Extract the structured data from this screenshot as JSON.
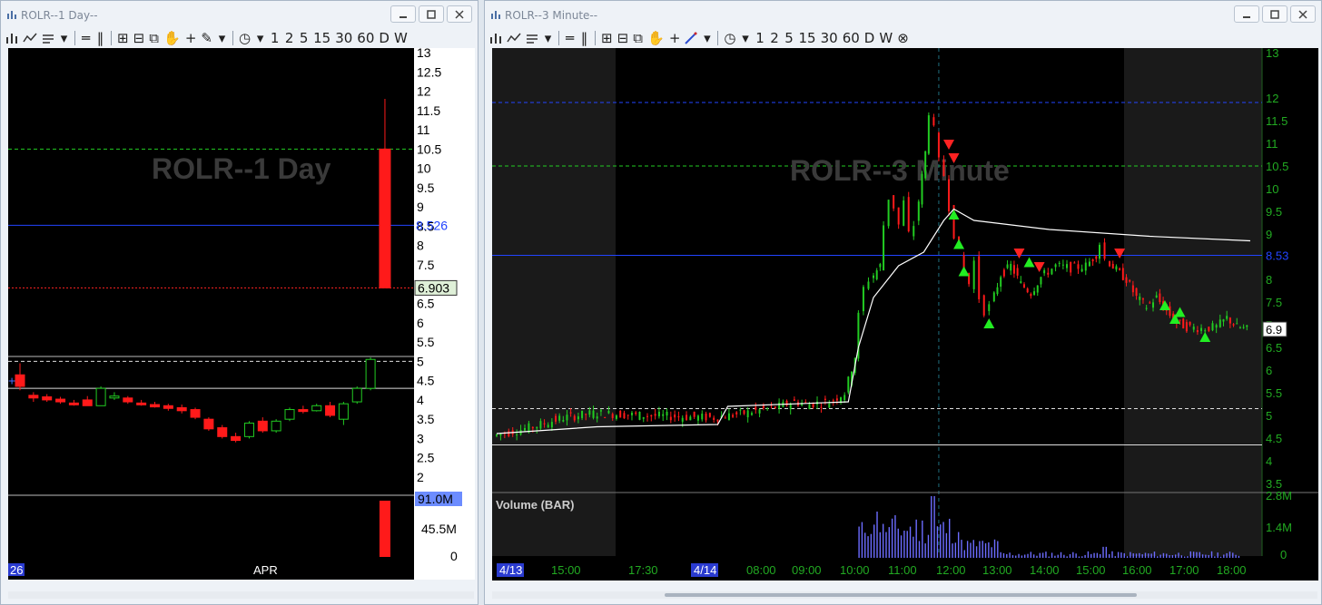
{
  "windows": {
    "left": {
      "title": "ROLR--1 Day--",
      "toolbar": [
        "1",
        "2",
        "5",
        "15",
        "30",
        "60",
        "D",
        "W"
      ],
      "watermark": "ROLR--1 Day",
      "price_tag": "8.526",
      "last_tag": "6.903",
      "vol_tag": "91.0M",
      "date_labels": [
        "26",
        "APR"
      ]
    },
    "right": {
      "title": "ROLR--3 Minute--",
      "toolbar": [
        "1",
        "2",
        "5",
        "15",
        "30",
        "60",
        "D",
        "W"
      ],
      "watermark": "ROLR--3 Minute",
      "price_tag": "8.53",
      "last_tag": "6.9",
      "volume_label": "Volume (BAR)",
      "date_labels": [
        "4/13",
        "15:00",
        "17:30",
        "4/14",
        "08:00",
        "09:00",
        "10:00",
        "11:00",
        "12:00",
        "13:00",
        "14:00",
        "15:00",
        "16:00",
        "17:00",
        "18:00"
      ]
    }
  },
  "colors": {
    "up": "#22cc22",
    "down": "#ff1a1a",
    "hline_green": "#22cc22",
    "hline_blue": "#2244ff",
    "hline_red": "#ff2222",
    "vwap": "#ffffff",
    "volume": "#6c6cff",
    "axis_text_right": "#22aa22"
  },
  "chart_data": [
    {
      "type": "candlestick",
      "title": "ROLR--1 Day",
      "ylim": [
        1.5,
        13
      ],
      "yticks": [
        "13",
        "12.5",
        "12",
        "11.5",
        "11",
        "10.5",
        "10",
        "9.5",
        "9",
        "8.5",
        "8",
        "7.5",
        "7",
        "6.5",
        "6",
        "5.5",
        "5",
        "4.5",
        "4",
        "3.5",
        "3",
        "2.5",
        "2"
      ],
      "hlines": [
        {
          "value": 10.5,
          "style": "dashed",
          "color": "green"
        },
        {
          "value": 8.526,
          "style": "solid",
          "color": "blue"
        },
        {
          "value": 6.903,
          "style": "dotted",
          "color": "red"
        },
        {
          "value": 5.0,
          "style": "dashed",
          "color": "white"
        },
        {
          "value": 4.3,
          "style": "solid",
          "color": "white"
        }
      ],
      "candles": [
        {
          "o": 4.65,
          "h": 4.95,
          "l": 4.25,
          "c": 4.35
        },
        {
          "o": 4.12,
          "h": 4.2,
          "l": 3.95,
          "c": 4.05
        },
        {
          "o": 4.08,
          "h": 4.15,
          "l": 3.95,
          "c": 4.0
        },
        {
          "o": 4.02,
          "h": 4.08,
          "l": 3.9,
          "c": 3.95
        },
        {
          "o": 3.92,
          "h": 4.0,
          "l": 3.85,
          "c": 3.88
        },
        {
          "o": 4.0,
          "h": 4.1,
          "l": 3.85,
          "c": 3.85
        },
        {
          "o": 3.85,
          "h": 4.35,
          "l": 3.85,
          "c": 4.3
        },
        {
          "o": 4.05,
          "h": 4.2,
          "l": 4.0,
          "c": 4.1
        },
        {
          "o": 4.05,
          "h": 4.1,
          "l": 3.9,
          "c": 3.95
        },
        {
          "o": 3.92,
          "h": 4.0,
          "l": 3.85,
          "c": 3.88
        },
        {
          "o": 3.88,
          "h": 3.95,
          "l": 3.8,
          "c": 3.82
        },
        {
          "o": 3.85,
          "h": 3.9,
          "l": 3.72,
          "c": 3.78
        },
        {
          "o": 3.8,
          "h": 3.88,
          "l": 3.65,
          "c": 3.72
        },
        {
          "o": 3.75,
          "h": 3.8,
          "l": 3.5,
          "c": 3.55
        },
        {
          "o": 3.5,
          "h": 3.55,
          "l": 3.2,
          "c": 3.25
        },
        {
          "o": 3.28,
          "h": 3.35,
          "l": 3.0,
          "c": 3.05
        },
        {
          "o": 3.05,
          "h": 3.15,
          "l": 2.9,
          "c": 2.95
        },
        {
          "o": 3.05,
          "h": 3.45,
          "l": 3.0,
          "c": 3.4
        },
        {
          "o": 3.45,
          "h": 3.55,
          "l": 3.15,
          "c": 3.2
        },
        {
          "o": 3.2,
          "h": 3.5,
          "l": 3.15,
          "c": 3.45
        },
        {
          "o": 3.5,
          "h": 3.8,
          "l": 3.45,
          "c": 3.75
        },
        {
          "o": 3.75,
          "h": 3.85,
          "l": 3.65,
          "c": 3.7
        },
        {
          "o": 3.72,
          "h": 3.9,
          "l": 3.7,
          "c": 3.85
        },
        {
          "o": 3.85,
          "h": 3.95,
          "l": 3.55,
          "c": 3.6
        },
        {
          "o": 3.5,
          "h": 3.95,
          "l": 3.35,
          "c": 3.9
        },
        {
          "o": 3.95,
          "h": 4.35,
          "l": 3.9,
          "c": 4.3
        },
        {
          "o": 4.3,
          "h": 5.1,
          "l": 4.25,
          "c": 5.05
        },
        {
          "o": 10.5,
          "h": 11.8,
          "l": 6.9,
          "c": 6.903
        }
      ],
      "volume": {
        "ylim": [
          0,
          91
        ],
        "yticks": [
          "91.0M",
          "45.5M",
          "0"
        ],
        "last_bar_millions": 91
      },
      "xlabels": [
        "26",
        "APR"
      ]
    },
    {
      "type": "candlestick",
      "title": "ROLR--3 Minute",
      "ylim": [
        3.5,
        13
      ],
      "yticks": [
        "13",
        "12",
        "11.5",
        "11",
        "10.5",
        "10",
        "9.5",
        "9",
        "8.53",
        "8",
        "7.5",
        "7",
        "6.5",
        "6",
        "5.5",
        "5",
        "4.5",
        "4",
        "3.5"
      ],
      "hlines": [
        {
          "value": 11.9,
          "style": "dashed",
          "color": "blue"
        },
        {
          "value": 10.5,
          "style": "dashed",
          "color": "green"
        },
        {
          "value": 8.53,
          "style": "solid",
          "color": "blue"
        },
        {
          "value": 5.15,
          "style": "dashed",
          "color": "white"
        },
        {
          "value": 4.35,
          "style": "solid",
          "color": "white"
        }
      ],
      "price_path": [
        [
          0,
          4.55
        ],
        [
          8,
          4.75
        ],
        [
          14,
          4.95
        ],
        [
          20,
          5.05
        ],
        [
          30,
          5.0
        ],
        [
          44,
          4.95
        ],
        [
          50,
          5.05
        ],
        [
          57,
          5.2
        ],
        [
          60,
          5.3
        ],
        [
          63,
          5.25
        ],
        [
          67,
          5.3
        ],
        [
          70,
          5.5
        ],
        [
          72,
          6.3
        ],
        [
          73,
          7.2
        ],
        [
          74,
          7.8
        ],
        [
          75,
          8.0
        ],
        [
          77,
          8.3
        ],
        [
          78,
          9.2
        ],
        [
          79,
          9.8
        ],
        [
          80,
          9.6
        ],
        [
          81,
          9.2
        ],
        [
          82,
          9.7
        ],
        [
          83,
          9.0
        ],
        [
          84,
          9.2
        ],
        [
          86,
          10.8
        ],
        [
          87,
          11.7
        ],
        [
          88,
          11.3
        ],
        [
          89,
          10.6
        ],
        [
          90,
          10.3
        ],
        [
          91,
          9.6
        ],
        [
          92,
          9.0
        ],
        [
          93,
          8.6
        ],
        [
          94,
          8.2
        ],
        [
          95,
          7.9
        ],
        [
          96,
          8.4
        ],
        [
          97,
          7.6
        ],
        [
          98,
          7.3
        ],
        [
          99,
          7.4
        ],
        [
          101,
          8.1
        ],
        [
          103,
          8.3
        ],
        [
          105,
          7.9
        ],
        [
          107,
          7.7
        ],
        [
          109,
          8.05
        ],
        [
          112,
          8.3
        ],
        [
          115,
          8.25
        ],
        [
          118,
          8.3
        ],
        [
          120,
          8.55
        ],
        [
          121,
          8.8
        ],
        [
          122,
          8.45
        ],
        [
          124,
          8.2
        ],
        [
          126,
          8.0
        ],
        [
          128,
          7.6
        ],
        [
          130,
          7.4
        ],
        [
          132,
          7.6
        ],
        [
          134,
          7.3
        ],
        [
          136,
          7.05
        ],
        [
          138,
          6.95
        ],
        [
          141,
          6.92
        ],
        [
          144,
          6.95
        ],
        [
          146,
          7.15
        ],
        [
          148,
          6.95
        ],
        [
          150,
          6.9
        ]
      ],
      "vwap_path": [
        [
          0,
          4.6
        ],
        [
          20,
          4.75
        ],
        [
          44,
          4.8
        ],
        [
          46,
          5.2
        ],
        [
          70,
          5.3
        ],
        [
          72,
          6.5
        ],
        [
          75,
          7.6
        ],
        [
          80,
          8.3
        ],
        [
          85,
          8.6
        ],
        [
          89,
          9.3
        ],
        [
          91,
          9.55
        ],
        [
          95,
          9.3
        ],
        [
          110,
          9.1
        ],
        [
          130,
          8.95
        ],
        [
          150,
          8.85
        ]
      ],
      "buy_markers": [
        [
          91,
          9.6
        ],
        [
          92,
          8.95
        ],
        [
          93,
          8.35
        ],
        [
          98,
          7.2
        ],
        [
          106,
          8.55
        ],
        [
          133,
          7.6
        ],
        [
          135,
          7.3
        ],
        [
          136,
          7.45
        ],
        [
          141,
          6.9
        ]
      ],
      "sell_markers": [
        [
          90,
          10.8
        ],
        [
          91,
          10.5
        ],
        [
          104,
          8.4
        ],
        [
          108,
          8.1
        ],
        [
          124,
          8.4
        ]
      ],
      "volume": {
        "ylim": [
          0,
          2.8
        ],
        "yticks": [
          "2.8M",
          "1.4M",
          "0"
        ],
        "label": "Volume (BAR)"
      },
      "xlabels": [
        "4/13",
        "15:00",
        "17:30",
        "4/14",
        "08:00",
        "09:00",
        "10:00",
        "11:00",
        "12:00",
        "13:00",
        "14:00",
        "15:00",
        "16:00",
        "17:00",
        "18:00"
      ]
    }
  ]
}
